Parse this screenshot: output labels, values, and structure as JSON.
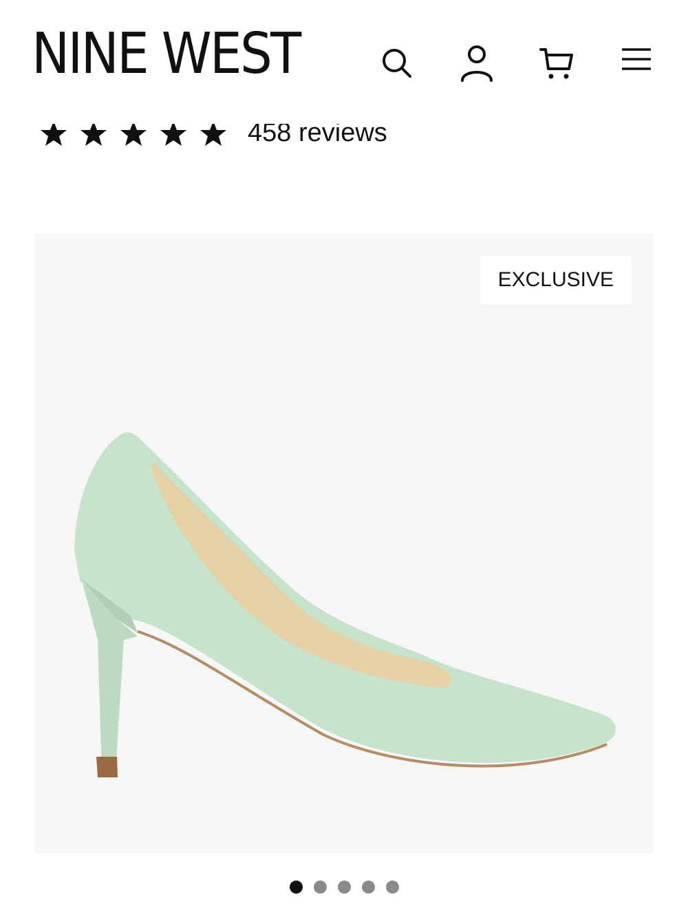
{
  "header": {
    "logo": "NINE WEST",
    "icons": [
      "search-icon",
      "account-icon",
      "cart-icon",
      "menu-icon"
    ]
  },
  "rating": {
    "stars": 5,
    "max_stars": 5,
    "review_count_text": "458 reviews"
  },
  "gallery": {
    "badge": "EXCLUSIVE",
    "image_count": 5,
    "active_index": 0,
    "colors": {
      "background": "#f6f6f7",
      "shoe_upper": "#c7e3cc",
      "shoe_lining": "#e6d0a6",
      "heel_tip": "#9a6a44"
    }
  }
}
